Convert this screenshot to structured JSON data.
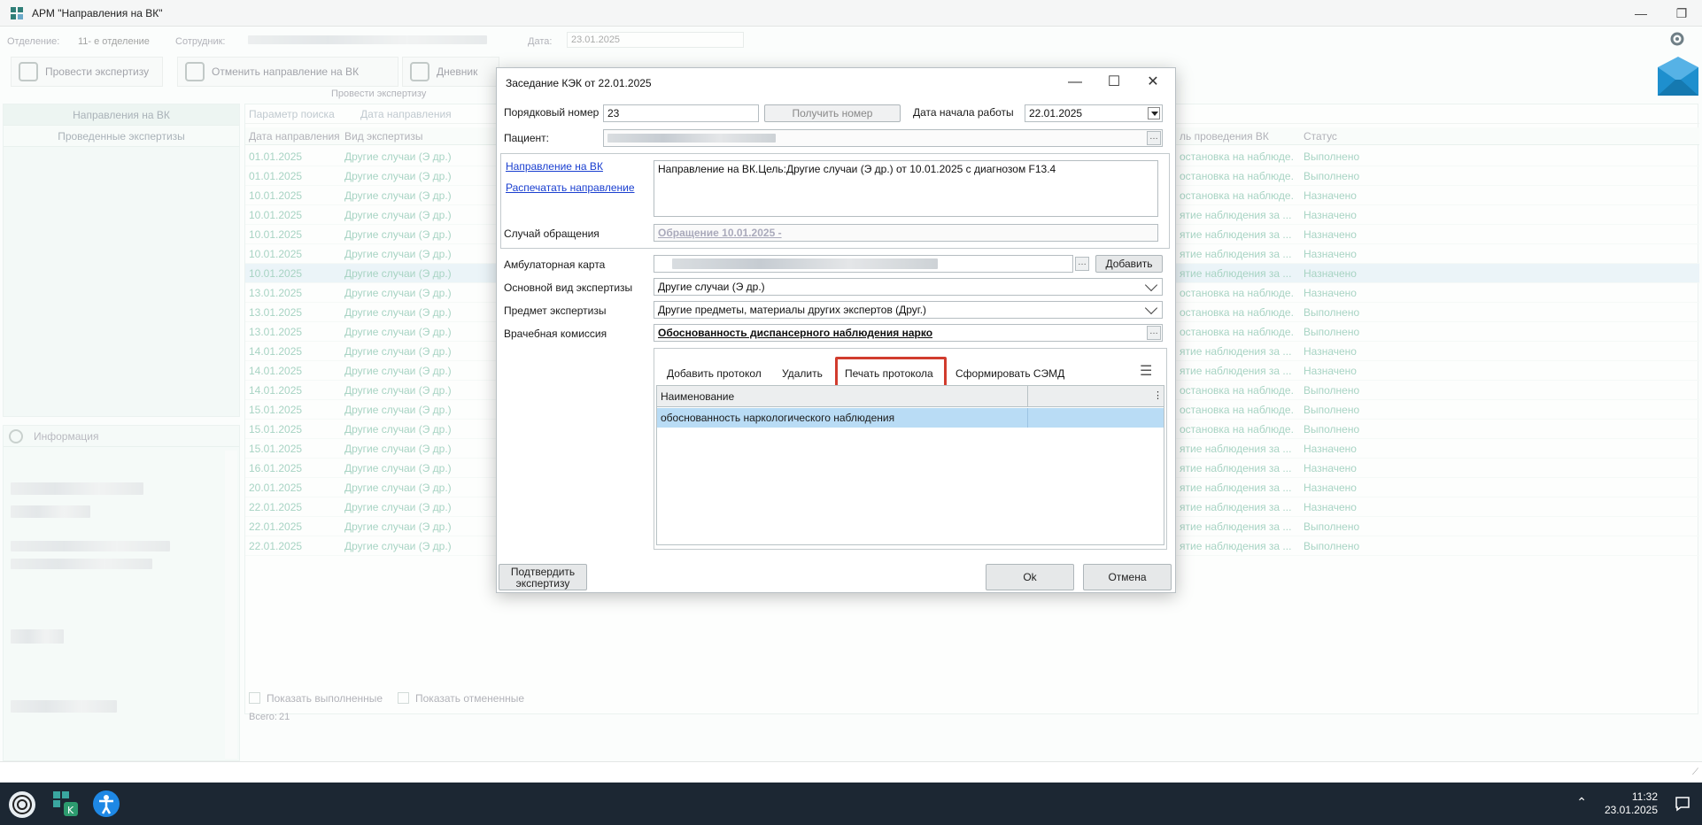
{
  "window": {
    "title": "АРМ \"Направления на ВК\""
  },
  "filters": {
    "department_label": "Отделение:",
    "department_value": "11- е отделение",
    "employee_label": "Сотрудник:",
    "date_label": "Дата:",
    "date_value": "23.01.2025"
  },
  "toolbar": {
    "examine_label": "Провести экспертизу",
    "cancel_referral_label": "Отменить направление на ВК",
    "diary_label": "Дневник",
    "group_caption": "Провести экспертизу"
  },
  "leftnav": {
    "items": [
      {
        "label": "Направления на ВК"
      },
      {
        "label": "Проведенные экспертизы"
      }
    ]
  },
  "info_panel": {
    "title": "Информация"
  },
  "grid": {
    "search_param_label": "Параметр поиска",
    "search_param_value": "Дата направления",
    "columns": {
      "date": "Дата направления",
      "kind": "Вид экспертизы",
      "purpose": "ль проведения ВК",
      "status": "Статус"
    },
    "rows": [
      {
        "date": "01.01.2025",
        "kind": "Другие случаи (Э др.)",
        "purpose": "остановка на наблюде...",
        "status": "Выполнено"
      },
      {
        "date": "01.01.2025",
        "kind": "Другие случаи (Э др.)",
        "purpose": "остановка на наблюде...",
        "status": "Выполнено"
      },
      {
        "date": "10.01.2025",
        "kind": "Другие случаи (Э др.)",
        "purpose": "остановка на наблюде...",
        "status": "Назначено"
      },
      {
        "date": "10.01.2025",
        "kind": "Другие случаи (Э др.)",
        "purpose": "ятие наблюдения за ...",
        "status": "Назначено"
      },
      {
        "date": "10.01.2025",
        "kind": "Другие случаи (Э др.)",
        "purpose": "ятие наблюдения за ...",
        "status": "Назначено"
      },
      {
        "date": "10.01.2025",
        "kind": "Другие случаи (Э др.)",
        "purpose": "ятие наблюдения за ...",
        "status": "Назначено"
      },
      {
        "date": "10.01.2025",
        "kind": "Другие случаи (Э др.)",
        "purpose": "ятие наблюдения за ...",
        "status": "Назначено"
      },
      {
        "date": "13.01.2025",
        "kind": "Другие случаи (Э др.)",
        "purpose": "остановка на наблюде...",
        "status": "Назначено"
      },
      {
        "date": "13.01.2025",
        "kind": "Другие случаи (Э др.)",
        "purpose": "остановка на наблюде...",
        "status": "Выполнено"
      },
      {
        "date": "13.01.2025",
        "kind": "Другие случаи (Э др.)",
        "purpose": "остановка на наблюде...",
        "status": "Выполнено"
      },
      {
        "date": "14.01.2025",
        "kind": "Другие случаи (Э др.)",
        "purpose": "ятие наблюдения за ...",
        "status": "Назначено"
      },
      {
        "date": "14.01.2025",
        "kind": "Другие случаи (Э др.)",
        "purpose": "ятие наблюдения за ...",
        "status": "Назначено"
      },
      {
        "date": "14.01.2025",
        "kind": "Другие случаи (Э др.)",
        "purpose": "остановка на наблюде...",
        "status": "Выполнено"
      },
      {
        "date": "15.01.2025",
        "kind": "Другие случаи (Э др.)",
        "purpose": "остановка на наблюде...",
        "status": "Выполнено"
      },
      {
        "date": "15.01.2025",
        "kind": "Другие случаи (Э др.)",
        "purpose": "остановка на наблюде...",
        "status": "Выполнено"
      },
      {
        "date": "15.01.2025",
        "kind": "Другие случаи (Э др.)",
        "purpose": "ятие наблюдения за ...",
        "status": "Назначено"
      },
      {
        "date": "16.01.2025",
        "kind": "Другие случаи (Э др.)",
        "purpose": "ятие наблюдения за ...",
        "status": "Назначено"
      },
      {
        "date": "20.01.2025",
        "kind": "Другие случаи (Э др.)",
        "purpose": "ятие наблюдения за ...",
        "status": "Назначено"
      },
      {
        "date": "22.01.2025",
        "kind": "Другие случаи (Э др.)",
        "purpose": "ятие наблюдения за ...",
        "status": "Назначено"
      },
      {
        "date": "22.01.2025",
        "kind": "Другие случаи (Э др.)",
        "purpose": "ятие наблюдения за ...",
        "status": "Выполнено"
      },
      {
        "date": "22.01.2025",
        "kind": "Другие случаи (Э др.)",
        "purpose": "ятие наблюдения за ...",
        "status": "Выполнено"
      }
    ],
    "selected_row_index": 6,
    "show_completed_label": "Показать выполненные",
    "show_cancelled_label": "Показать отмененные",
    "total_label": "Всего:",
    "total_value": "21"
  },
  "dialog": {
    "title": "Заседание КЭК от 22.01.2025",
    "order_number_label": "Порядковый номер",
    "order_number_value": "23",
    "get_number_button": "Получить номер",
    "start_date_label": "Дата начала работы",
    "start_date_value": "22.01.2025",
    "patient_label": "Пациент:",
    "referral_link": "Направление на ВК",
    "print_referral_link": "Распечатать направление",
    "referral_text": "Направление на ВК.Цель:Другие случаи (Э др.) от 10.01.2025 с диагнозом F13.4",
    "case_label": "Случай обращения",
    "case_value": "Обращение 10.01.2025 -",
    "outpatient_card_label": "Амбулаторная карта",
    "add_button": "Добавить",
    "main_kind_label": "Основной вид экспертизы",
    "main_kind_value": "Другие случаи (Э др.)",
    "subject_label": "Предмет экспертизы",
    "subject_value": "Другие предметы, материалы других экспертов (Друг.)",
    "commission_label": "Врачебная комиссия",
    "commission_value": "Обоснованность диспансерного наблюдения  нарко",
    "protocol_toolbar": {
      "add_protocol": "Добавить протокол",
      "delete": "Удалить",
      "print_protocol": "Печать протокола",
      "form_semd": "Сформировать СЭМД"
    },
    "protocol_grid": {
      "column_name": "Наименование",
      "rows": [
        {
          "name": "обоснованность наркологического наблюдения"
        }
      ]
    },
    "confirm_button": "Подтвердить экспертизу",
    "ok_button": "Ok",
    "cancel_button": "Отмена"
  },
  "taskbar": {
    "time": "11:32",
    "date": "23.01.2025"
  },
  "colors": {
    "accent_green": "#3fa07e",
    "highlight_red": "#d13c2e",
    "selection_blue": "#b9dcf5",
    "taskbar": "#1c2733"
  }
}
